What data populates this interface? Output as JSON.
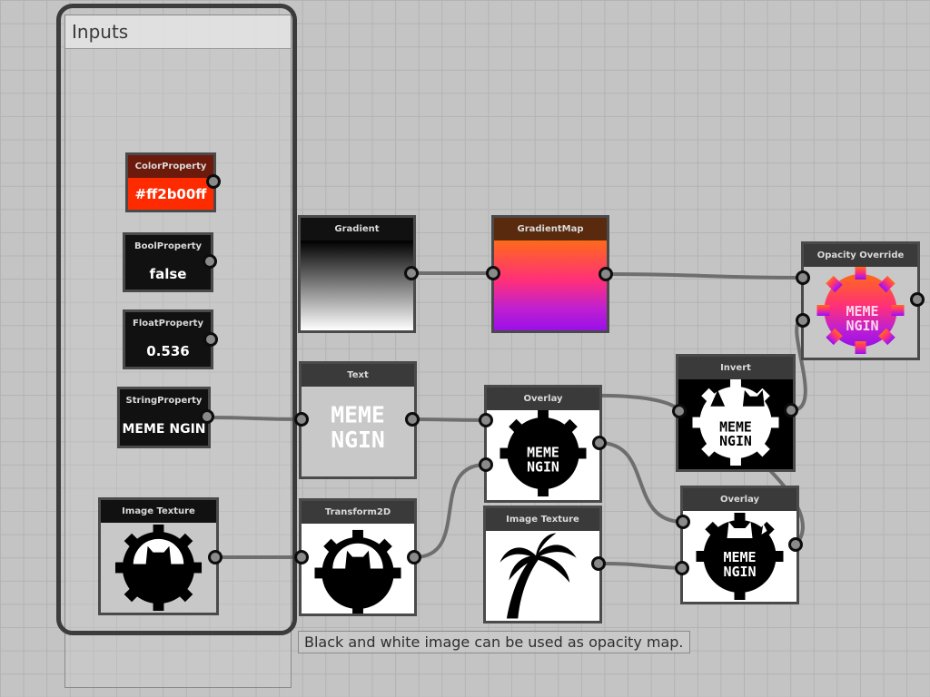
{
  "group": {
    "title": "Inputs"
  },
  "nodes": {
    "color_property": {
      "title": "ColorProperty",
      "value": "#ff2b00ff"
    },
    "bool_property": {
      "title": "BoolProperty",
      "value": "false"
    },
    "float_property": {
      "title": "FloatProperty",
      "value": "0.536"
    },
    "string_property": {
      "title": "StringProperty",
      "value": "MEME NGIN"
    },
    "image_texture_input": {
      "title": "Image Texture"
    },
    "gradient": {
      "title": "Gradient"
    },
    "gradient_map": {
      "title": "GradientMap"
    },
    "text": {
      "title": "Text",
      "line1": "MEME",
      "line2": "NGIN"
    },
    "transform2d": {
      "title": "Transform2D"
    },
    "overlay_top": {
      "title": "Overlay",
      "line1": "MEME",
      "line2": "NGIN"
    },
    "image_texture_palm": {
      "title": "Image Texture"
    },
    "invert": {
      "title": "Invert",
      "line1": "MEME",
      "line2": "NGIN"
    },
    "overlay_bottom": {
      "title": "Overlay",
      "line1": "MEME",
      "line2": "NGIN"
    },
    "opacity_override": {
      "title": "Opacity Override",
      "line1": "MEME",
      "line2": "NGIN"
    }
  },
  "note": {
    "text": "Black and white image can be used as opacity map."
  },
  "colors": {
    "color_property_header": "#6b1a0c",
    "color_property_value": "#ff2b00",
    "gradient_map_header": "#5a2a0f",
    "gradient_map_stops": [
      "#ff6a1a",
      "#ff2f7a",
      "#c020d0",
      "#9a10e8"
    ],
    "opacity_override_stops": [
      "#ff6a1a",
      "#ff2f7a",
      "#c020d0",
      "#9a10e8"
    ]
  },
  "icons": [
    "gear-cat-logo",
    "palm-tree-icon",
    "socket-icon"
  ]
}
